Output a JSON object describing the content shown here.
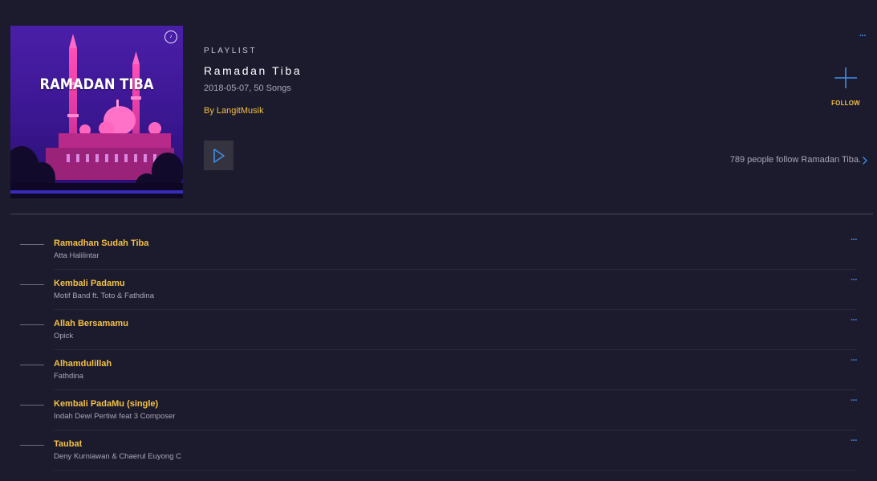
{
  "colors": {
    "background": "#1c1a2d",
    "accent_gold": "#f4c243",
    "accent_blue": "#3d8fe8"
  },
  "playlist": {
    "cover_title": "RAMADAN TIBA",
    "type_label": "PLAYLIST",
    "title": "Ramadan Tiba",
    "meta": "2018-05-07, 50 Songs",
    "by": "By LangitMusik",
    "followers_text": "789 people follow Ramadan Tiba.",
    "follow_label": "FOLLOW",
    "more_icon": "ellipsis-icon",
    "play_icon": "play-icon",
    "follow_icon": "plus-icon",
    "chevron_icon": "chevron-right-icon"
  },
  "tracks": [
    {
      "title": "Ramadhan Sudah Tiba",
      "artist": "Atta Halilintar"
    },
    {
      "title": "Kembali Padamu",
      "artist": "Motif Band ft. Toto & Fathdina"
    },
    {
      "title": "Allah Bersamamu",
      "artist": "Opick"
    },
    {
      "title": "Alhamdulillah",
      "artist": "Fathdina"
    },
    {
      "title": "Kembali PadaMu (single)",
      "artist": "Indah Dewi Pertiwi feat 3 Composer"
    },
    {
      "title": "Taubat",
      "artist": "Deny Kurniawan & Chaerul Euyong C"
    }
  ]
}
